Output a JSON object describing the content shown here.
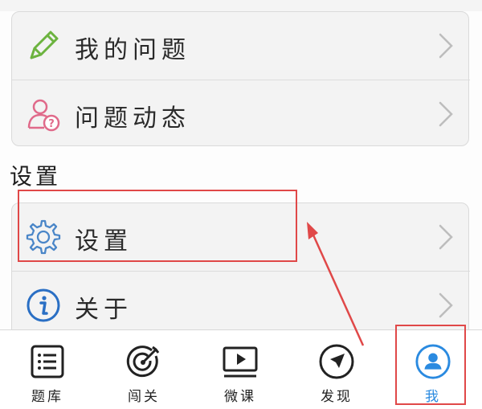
{
  "menu": {
    "items": [
      {
        "label": "我的问题",
        "icon": "pencil-icon"
      },
      {
        "label": "问题动态",
        "icon": "user-question-icon"
      }
    ]
  },
  "settings_section": {
    "title": "设置",
    "items": [
      {
        "label": "设置",
        "icon": "gear-icon"
      },
      {
        "label": "关于",
        "icon": "info-icon"
      }
    ]
  },
  "tabbar": {
    "tabs": [
      {
        "label": "题库",
        "icon": "list-icon",
        "active": false
      },
      {
        "label": "闯关",
        "icon": "target-icon",
        "active": false
      },
      {
        "label": "微课",
        "icon": "play-icon",
        "active": false
      },
      {
        "label": "发现",
        "icon": "compass-arrow-icon",
        "active": false
      },
      {
        "label": "我",
        "icon": "profile-icon",
        "active": true
      }
    ]
  },
  "colors": {
    "accent": "#2a8ae0",
    "annotation": "#e04848",
    "pencil": "#6cb33f",
    "user_question": "#e06a8a",
    "gear": "#4a86c8",
    "info": "#2a6fc4"
  }
}
